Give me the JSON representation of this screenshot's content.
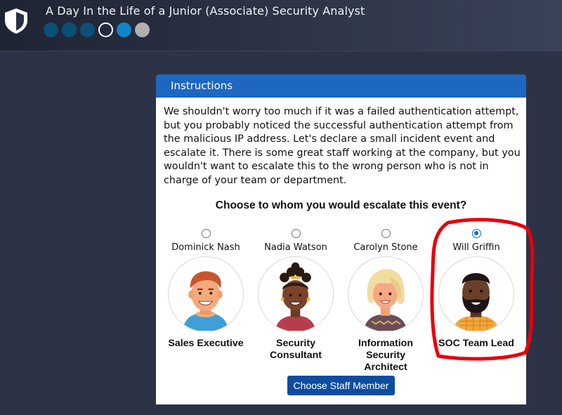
{
  "app": {
    "title": "A Day In the Life of a Junior (Associate) Security Analyst",
    "progress": [
      "done",
      "done",
      "done",
      "current",
      "next",
      "locked"
    ]
  },
  "panel": {
    "header": "Instructions",
    "text": "We shouldn't worry too much if it was a failed authentication attempt, but you probably noticed the successful authentication attempt from the malicious IP address. Let's declare a small incident event and escalate it. There is some great staff working at the company, but you wouldn't want to escalate this to the wrong person who is not in charge of your team or department.",
    "question": "Choose to whom you would escalate this event?",
    "staff": [
      {
        "name": "Dominick Nash",
        "role": "Sales Executive",
        "selected": false
      },
      {
        "name": "Nadia Watson",
        "role": "Security Consultant",
        "selected": false
      },
      {
        "name": "Carolyn Stone",
        "role": "Information Security Architect",
        "selected": false
      },
      {
        "name": "Will Griffin",
        "role": "SOC Team Lead",
        "selected": true
      }
    ],
    "button": "Choose Staff Member"
  },
  "colors": {
    "header_blue": "#1e67c0",
    "button_blue": "#0d4da0",
    "highlight_red": "#e8000b",
    "background": "#2d3346"
  }
}
